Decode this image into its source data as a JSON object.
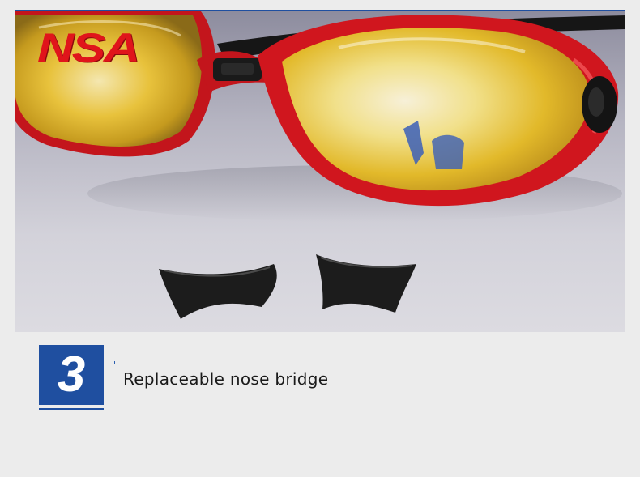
{
  "brand": {
    "logo_text": "NSA",
    "logo_color": "#e0151b"
  },
  "feature": {
    "step_number": "3",
    "caption": "Replaceable nose bridge"
  },
  "colors": {
    "accent_blue": "#1f4fa0",
    "page_background": "#ececec"
  }
}
